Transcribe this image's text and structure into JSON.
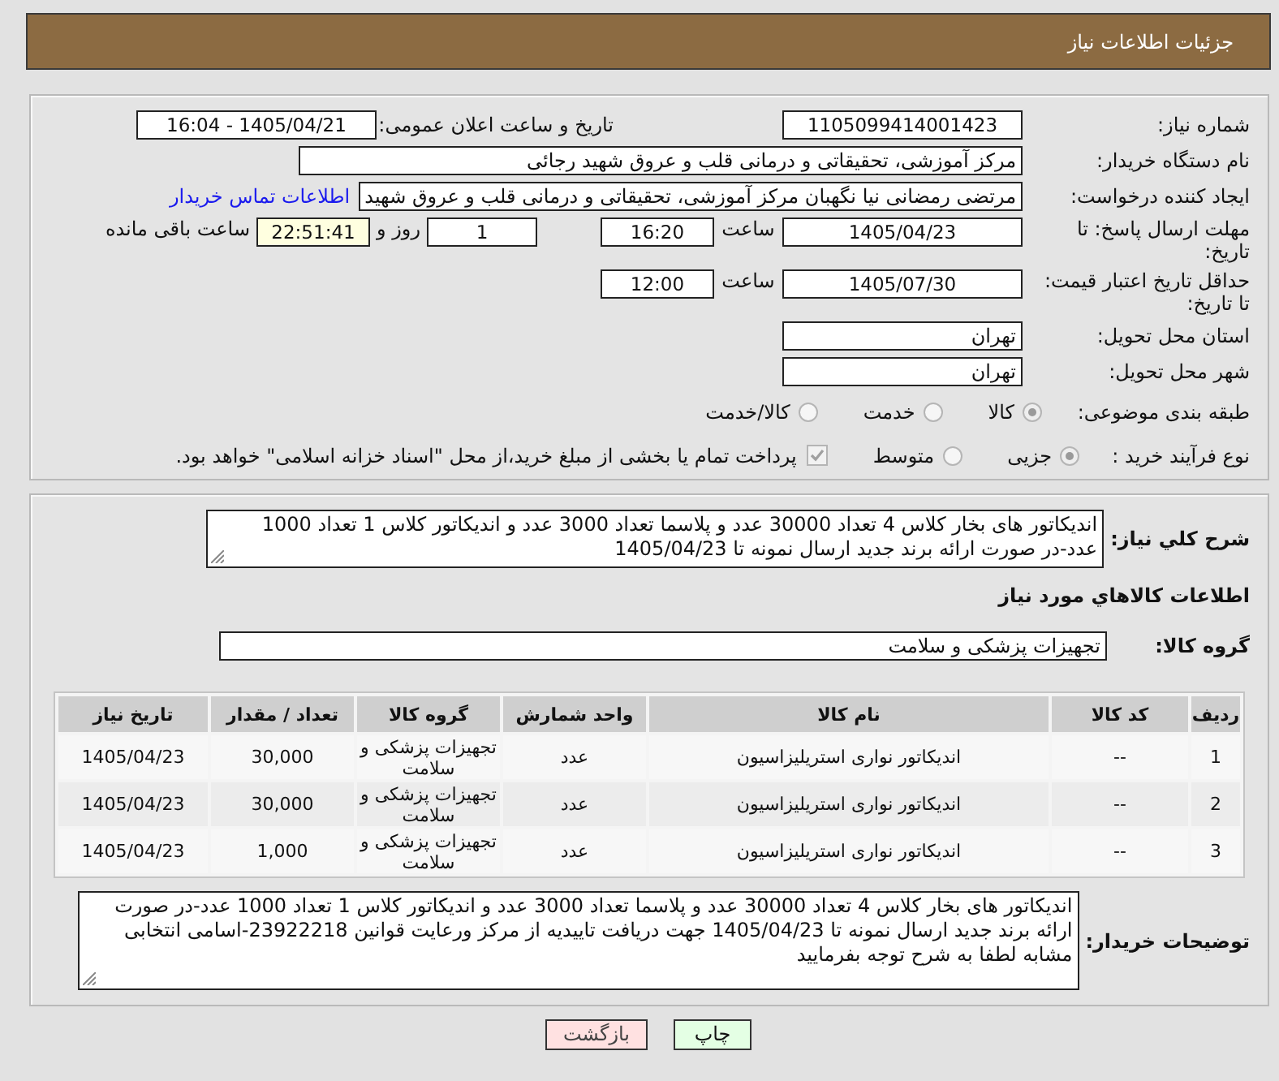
{
  "header": {
    "title": "جزئیات اطلاعات نیاز"
  },
  "summary": {
    "need_number": {
      "label": "شماره نیاز:",
      "value": "1105099414001423"
    },
    "announce": {
      "label": "تاریخ و ساعت اعلان عمومی:",
      "value": "1405/04/21 - 16:04"
    },
    "buyer": {
      "label": "نام دستگاه خریدار:",
      "value": "مرکز آموزشی، تحقیقاتی و درمانی قلب و عروق شهید رجائی"
    },
    "creator": {
      "label": "ایجاد کننده درخواست:",
      "value": "مرتضی رمضانی نیا نگهبان مرکز آموزشی، تحقیقاتی و درمانی قلب و عروق شهید",
      "link": "اطلاعات تماس خریدار"
    },
    "deadline": {
      "label": "مهلت ارسال پاسخ: تا تاریخ:",
      "date": "1405/04/23",
      "time_label": "ساعت",
      "time": "16:20",
      "days": "1",
      "days_label": "روز و",
      "remaining": "22:51:41",
      "remaining_label": "ساعت باقی مانده"
    },
    "validity": {
      "label": "حداقل تاریخ اعتبار قیمت: تا تاریخ:",
      "date": "1405/07/30",
      "time_label": "ساعت",
      "time": "12:00"
    },
    "province": {
      "label": "استان محل تحویل:",
      "value": "تهران"
    },
    "city": {
      "label": "شهر محل تحویل:",
      "value": "تهران"
    },
    "category": {
      "label": "طبقه بندی موضوعی:",
      "options": [
        {
          "label": "کالا",
          "selected": true
        },
        {
          "label": "خدمت",
          "selected": false
        },
        {
          "label": "کالا/خدمت",
          "selected": false
        }
      ]
    },
    "process": {
      "label": "نوع فرآیند خرید :",
      "options": [
        {
          "label": "جزیی",
          "selected": true
        },
        {
          "label": "متوسط",
          "selected": false
        }
      ],
      "treasury": {
        "label": "پرداخت تمام یا بخشی از مبلغ خرید،از محل \"اسناد خزانه اسلامی\" خواهد بود.",
        "checked": true
      }
    }
  },
  "needs": {
    "description": {
      "label": "شرح کلي نياز:",
      "value": "اندیکاتور های بخار کلاس 4 تعداد 30000 عدد و پلاسما تعداد 3000 عدد و اندیکاتور کلاس 1 تعداد 1000 عدد-در صورت ارائه برند جدید ارسال نمونه تا 1405/04/23"
    },
    "goods_title": "اطلاعات کالاهاي مورد نياز",
    "group": {
      "label": "گروه کالا:",
      "value": "تجهیزات پزشکی و سلامت"
    },
    "table": {
      "columns": [
        "ردیف",
        "کد کالا",
        "نام کالا",
        "واحد شمارش",
        "گروه کالا",
        "تعداد / مقدار",
        "تاریخ نیاز"
      ],
      "rows": [
        [
          "1",
          "--",
          "اندیکاتور نواری استریلیزاسیون",
          "عدد",
          "تجهیزات پزشکی و سلامت",
          "30,000",
          "1405/04/23"
        ],
        [
          "2",
          "--",
          "اندیکاتور نواری استریلیزاسیون",
          "عدد",
          "تجهیزات پزشکی و سلامت",
          "30,000",
          "1405/04/23"
        ],
        [
          "3",
          "--",
          "اندیکاتور نواری استریلیزاسیون",
          "عدد",
          "تجهیزات پزشکی و سلامت",
          "1,000",
          "1405/04/23"
        ]
      ]
    },
    "buyer_notes": {
      "label": "توضیحات خریدار:",
      "value": "اندیکاتور های بخار کلاس 4 تعداد 30000 عدد و پلاسما تعداد 3000 عدد و اندیکاتور کلاس 1 تعداد 1000 عدد-در صورت ارائه برند جدید ارسال نمونه تا 1405/04/23 جهت دریافت تاییدیه از مرکز ورعایت قوانین 23922218-اسامی انتخابی مشابه لطفا به شرح توجه بفرمایید"
    }
  },
  "buttons": [
    {
      "label": "چاپ",
      "kind": "print"
    },
    {
      "label": "بازگشت",
      "kind": "back"
    }
  ]
}
